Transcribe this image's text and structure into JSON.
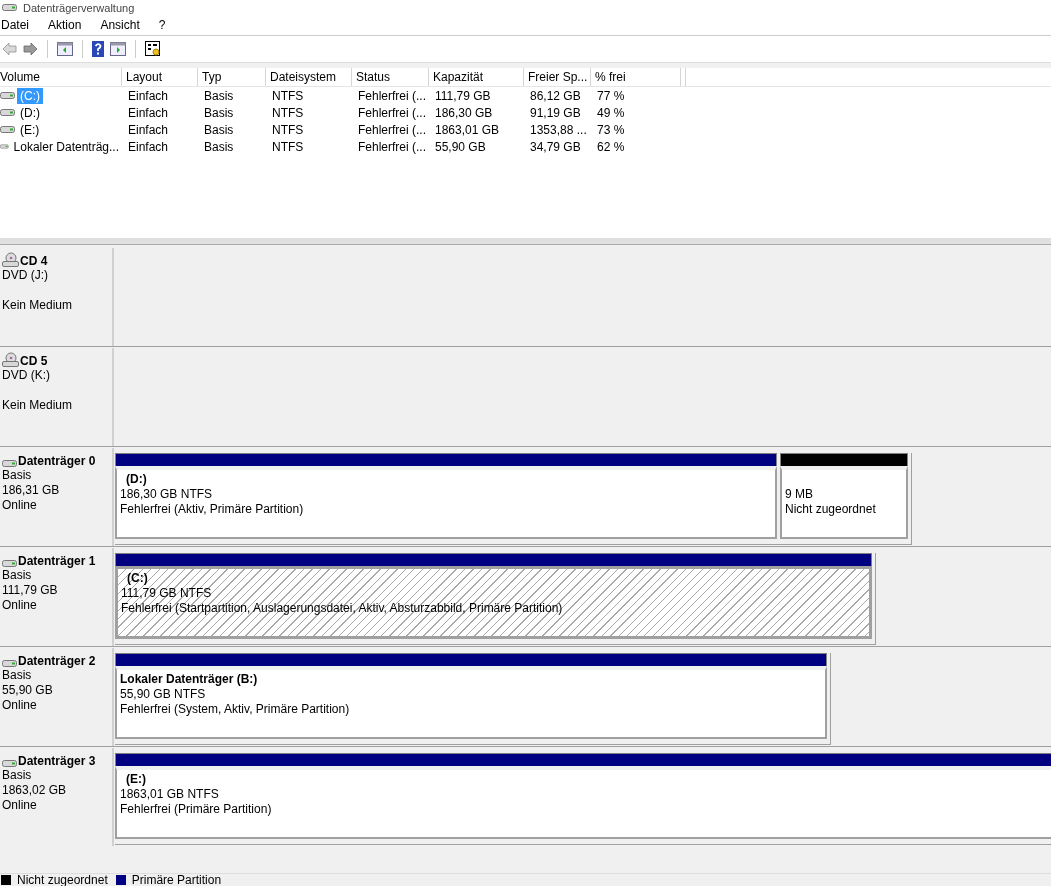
{
  "window": {
    "title": "Datenträgerverwaltung"
  },
  "menu": [
    "Datei",
    "Aktion",
    "Ansicht",
    "?"
  ],
  "toolbar": [
    {
      "kind": "back",
      "disabled": true
    },
    {
      "kind": "forward",
      "disabled": false
    },
    {
      "kind": "tree",
      "disabled": false
    },
    {
      "kind": "help",
      "disabled": false
    },
    {
      "kind": "pane",
      "disabled": false
    },
    {
      "kind": "properties",
      "disabled": false
    }
  ],
  "volume_table": {
    "columns": [
      "Volume",
      "Layout",
      "Typ",
      "Dateisystem",
      "Status",
      "Kapazität",
      "Freier Sp...",
      "% frei"
    ],
    "rows": [
      {
        "selected": true,
        "cells": [
          "(C:)",
          "Einfach",
          "Basis",
          "NTFS",
          "Fehlerfrei (...",
          "111,79 GB",
          "86,12 GB",
          "77 %"
        ]
      },
      {
        "selected": false,
        "cells": [
          "(D:)",
          "Einfach",
          "Basis",
          "NTFS",
          "Fehlerfrei (...",
          "186,30 GB",
          "91,19 GB",
          "49 %"
        ]
      },
      {
        "selected": false,
        "cells": [
          "(E:)",
          "Einfach",
          "Basis",
          "NTFS",
          "Fehlerfrei (...",
          "1863,01 GB",
          "1353,88 ...",
          "73 %"
        ]
      },
      {
        "selected": false,
        "cells": [
          "Lokaler Datenträg...",
          "Einfach",
          "Basis",
          "NTFS",
          "Fehlerfrei (...",
          "55,90 GB",
          "34,79 GB",
          "62 %"
        ]
      }
    ]
  },
  "disks": [
    {
      "kind": "cd",
      "name": "CD 4",
      "drive": "DVD (J:)",
      "media": "Kein Medium"
    },
    {
      "kind": "cd",
      "name": "CD 5",
      "drive": "DVD (K:)",
      "media": "Kein Medium"
    },
    {
      "kind": "disk",
      "name": "Datenträger 0",
      "lines": [
        "Basis",
        "186,31 GB",
        "Online"
      ],
      "partitions": [
        {
          "kind": "primary",
          "selected": false,
          "label": "(D:)",
          "size": "186,30 GB NTFS",
          "status": "Fehlerfrei (Aktiv, Primäre Partition)"
        },
        {
          "kind": "unallocated",
          "selected": false,
          "size": "9 MB",
          "status": "Nicht zugeordnet"
        }
      ]
    },
    {
      "kind": "disk",
      "name": "Datenträger 1",
      "lines": [
        "Basis",
        "111,79 GB",
        "Online"
      ],
      "partitions": [
        {
          "kind": "primary",
          "selected": true,
          "label": "(C:)",
          "size": "111,79 GB NTFS",
          "status": "Fehlerfrei (Startpartition, Auslagerungsdatei, Aktiv, Absturzabbild, Primäre Partition)"
        }
      ]
    },
    {
      "kind": "disk",
      "name": "Datenträger 2",
      "lines": [
        "Basis",
        "55,90 GB",
        "Online"
      ],
      "partitions": [
        {
          "kind": "primary",
          "selected": false,
          "label": "Lokaler Datenträger  (B:)",
          "size": "55,90 GB NTFS",
          "status": "Fehlerfrei (System, Aktiv, Primäre Partition)"
        }
      ]
    },
    {
      "kind": "disk",
      "name": "Datenträger 3",
      "lines": [
        "Basis",
        "1863,02 GB",
        "Online"
      ],
      "partitions": [
        {
          "kind": "primary",
          "selected": false,
          "label": "(E:)",
          "size": "1863,01 GB NTFS",
          "status": "Fehlerfrei (Primäre Partition)"
        }
      ]
    }
  ],
  "legend": [
    {
      "label": "Nicht zugeordnet",
      "color": "#000000"
    },
    {
      "label": "Primäre Partition",
      "color": "#000080"
    }
  ]
}
